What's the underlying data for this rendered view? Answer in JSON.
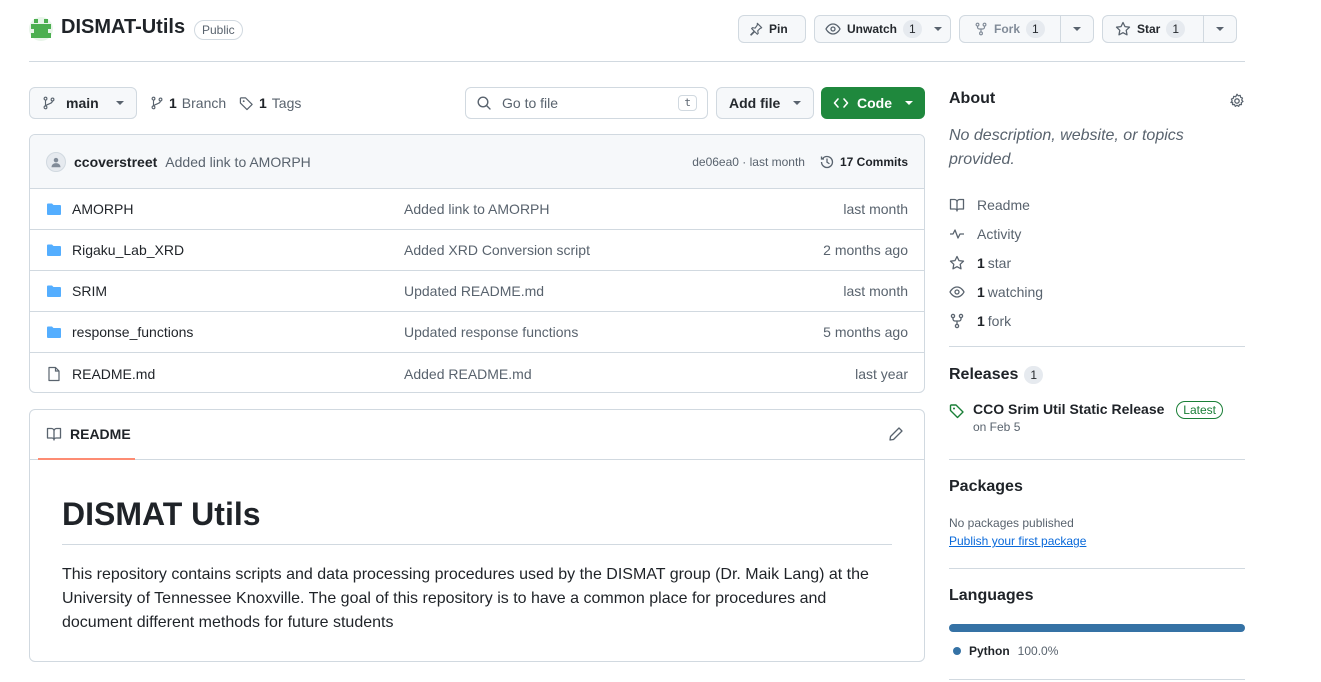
{
  "repo": {
    "name": "DISMAT-Utils",
    "visibility": "Public"
  },
  "header_actions": {
    "pin_label": "Pin",
    "watch_label": "Unwatch",
    "watch_count": "1",
    "fork_label": "Fork",
    "fork_count": "1",
    "star_label": "Star",
    "star_count": "1"
  },
  "branch_bar": {
    "branch": "main",
    "branch_count": "1",
    "branch_label": "Branch",
    "tag_count": "1",
    "tag_label": "Tags",
    "goto_placeholder": "Go to file",
    "goto_shortcut": "t",
    "add_file_label": "Add file",
    "code_label": "Code"
  },
  "latest_commit": {
    "author": "ccoverstreet",
    "message": "Added link to AMORPH",
    "hash_time": "de06ea0 · last month",
    "commits": "17 Commits"
  },
  "files": [
    {
      "type": "folder",
      "name": "AMORPH",
      "message": "Added link to AMORPH",
      "date": "last month"
    },
    {
      "type": "folder",
      "name": "Rigaku_Lab_XRD",
      "message": "Added XRD Conversion script",
      "date": "2 months ago"
    },
    {
      "type": "folder",
      "name": "SRIM",
      "message": "Updated README.md",
      "date": "last month"
    },
    {
      "type": "folder",
      "name": "response_functions",
      "message": "Updated response functions",
      "date": "5 months ago"
    },
    {
      "type": "file",
      "name": "README.md",
      "message": "Added README.md",
      "date": "last year"
    }
  ],
  "readme": {
    "tab_label": "README",
    "heading": "DISMAT Utils",
    "paragraph": "This repository contains scripts and data processing procedures used by the DISMAT group (Dr. Maik Lang) at the University of Tennessee Knoxville. The goal of this repository is to have a common place for procedures and document different methods for future students"
  },
  "about": {
    "title": "About",
    "description": "No description, website, or topics provided.",
    "items": [
      {
        "icon": "book-icon",
        "count": "",
        "label": "Readme"
      },
      {
        "icon": "pulse-icon",
        "count": "",
        "label": "Activity"
      },
      {
        "icon": "star-icon",
        "count": "1",
        "label": "star"
      },
      {
        "icon": "eye-icon",
        "count": "1",
        "label": "watching"
      },
      {
        "icon": "fork-icon",
        "count": "1",
        "label": "fork"
      }
    ]
  },
  "releases": {
    "title": "Releases",
    "count": "1",
    "name": "CCO Srim Util Static Release",
    "badge": "Latest",
    "date": "on Feb 5"
  },
  "packages": {
    "title": "Packages",
    "none_text": "No packages published",
    "link": "Publish your first package"
  },
  "languages": {
    "title": "Languages",
    "items": [
      {
        "name": "Python",
        "percent": "100.0%",
        "color": "#3572a5"
      }
    ]
  },
  "colors": {
    "primary_green": "#1f883d",
    "link_blue": "#0969da",
    "folder_blue": "#54aeff",
    "tab_underline": "#fd8c73"
  }
}
